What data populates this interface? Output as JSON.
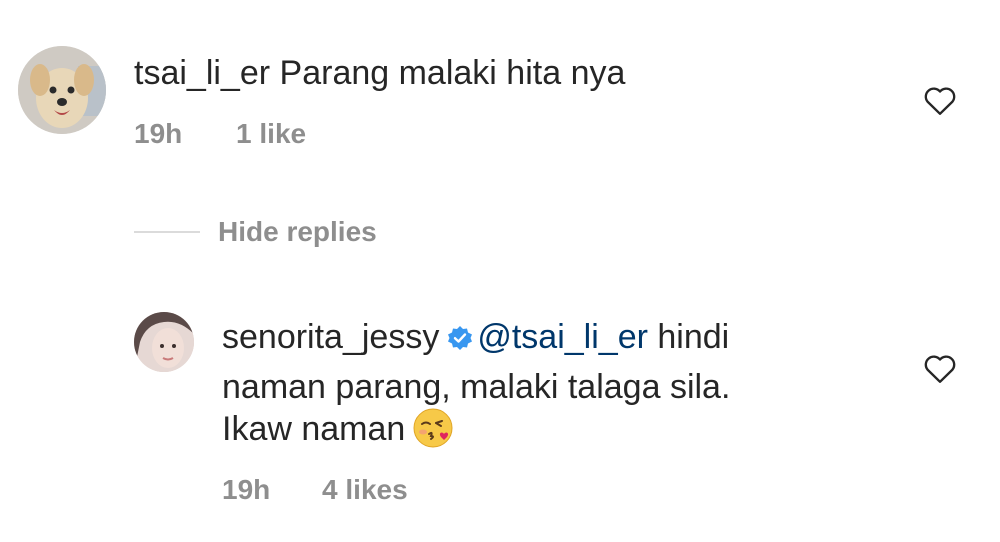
{
  "comment1": {
    "username": "tsai_li_er",
    "text": "Parang malaki hita nya",
    "time": "19h",
    "likes": "1 like",
    "avatar_icon": "dog-photo-avatar",
    "like_icon": "heart-outline-icon"
  },
  "replies_toggle": {
    "label": "Hide replies"
  },
  "reply1": {
    "username": "senorita_jessy",
    "mention": "@tsai_li_er",
    "text_line1": " hindi",
    "text_line2": "naman parang, malaki talaga sila.",
    "text_line3": "Ikaw naman",
    "time": "19h",
    "likes": "4 likes",
    "verified_icon": "verified-badge-icon",
    "emoji_icon": "kissing-face-emoji",
    "like_icon": "heart-outline-icon"
  },
  "colors": {
    "text": "#262626",
    "secondary": "#8e8e8e",
    "mention": "#00376b",
    "verified": "#3897f0"
  }
}
